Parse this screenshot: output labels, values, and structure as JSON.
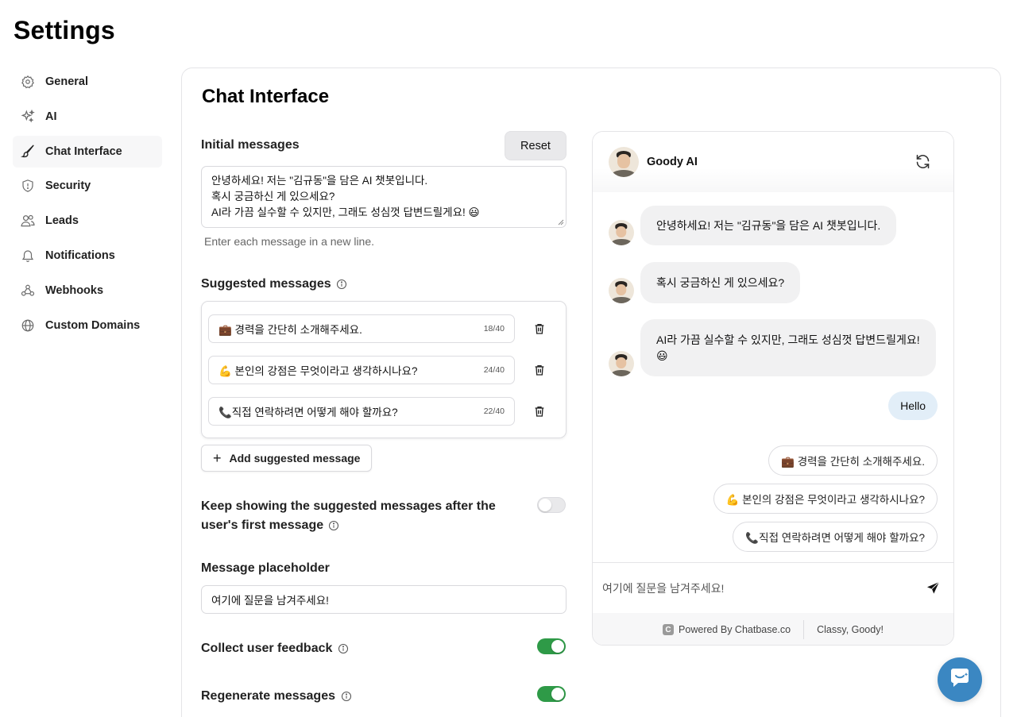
{
  "page": {
    "title": "Settings"
  },
  "sidebar": {
    "items": [
      {
        "label": "General",
        "icon": "gear-icon"
      },
      {
        "label": "AI",
        "icon": "sparkles-icon"
      },
      {
        "label": "Chat Interface",
        "icon": "brush-icon",
        "active": true
      },
      {
        "label": "Security",
        "icon": "shield-icon"
      },
      {
        "label": "Leads",
        "icon": "users-icon"
      },
      {
        "label": "Notifications",
        "icon": "bell-icon"
      },
      {
        "label": "Webhooks",
        "icon": "webhook-icon"
      },
      {
        "label": "Custom Domains",
        "icon": "globe-icon"
      }
    ]
  },
  "panel": {
    "title": "Chat Interface",
    "initial_messages": {
      "label": "Initial messages",
      "reset_label": "Reset",
      "lines": [
        "안녕하세요! 저는 \"김규동\"을 담은 AI 챗봇입니다.",
        "혹시 궁금하신 게 있으세요?",
        "AI라 가끔 실수할 수 있지만, 그래도 성심껏 답변드릴게요! 😃"
      ],
      "helper": "Enter each message in a new line."
    },
    "suggested_messages": {
      "label": "Suggested messages",
      "items": [
        {
          "text": "💼 경력을 간단히 소개해주세요.",
          "count": "18/40"
        },
        {
          "text": "💪 본인의 강점은 무엇이라고 생각하시나요?",
          "count": "24/40"
        },
        {
          "text": "📞직접 연락하려면 어떻게 해야 할까요?",
          "count": "22/40"
        }
      ],
      "add_label": "Add suggested message"
    },
    "keep_showing": {
      "label_line1": "Keep showing the suggested messages after the",
      "label_line2": "user's first message",
      "enabled": false
    },
    "message_placeholder": {
      "label": "Message placeholder",
      "value": "여기에 질문을 남겨주세요!"
    },
    "collect_feedback": {
      "label": "Collect user feedback",
      "enabled": true
    },
    "regenerate": {
      "label": "Regenerate messages",
      "enabled": true
    }
  },
  "chat_preview": {
    "bot_name": "Goody AI",
    "messages": [
      {
        "role": "bot",
        "text": "안녕하세요! 저는 \"김규동\"을 담은 AI 챗봇입니다."
      },
      {
        "role": "bot",
        "text": "혹시 궁금하신 게 있으세요?"
      },
      {
        "role": "bot",
        "line1": "AI라 가끔 실수할 수 있지만, 그래도 성심껏 답변드릴게요!",
        "line2": "😃"
      },
      {
        "role": "user",
        "text": "Hello"
      }
    ],
    "suggestions": [
      "💼 경력을 간단히 소개해주세요.",
      "💪 본인의 강점은 무엇이라고 생각하시나요?",
      "📞직접 연락하려면 어떻게 해야 할까요?"
    ],
    "input_placeholder": "여기에 질문을 남겨주세요!",
    "footer_powered": "Powered By Chatbase.co",
    "footer_logo_letter": "C",
    "footer_tagline": "Classy, Goody!"
  },
  "colors": {
    "toggle_on": "#2e9a47",
    "user_bubble": "#e2eef8",
    "launcher": "#3b87c2"
  }
}
